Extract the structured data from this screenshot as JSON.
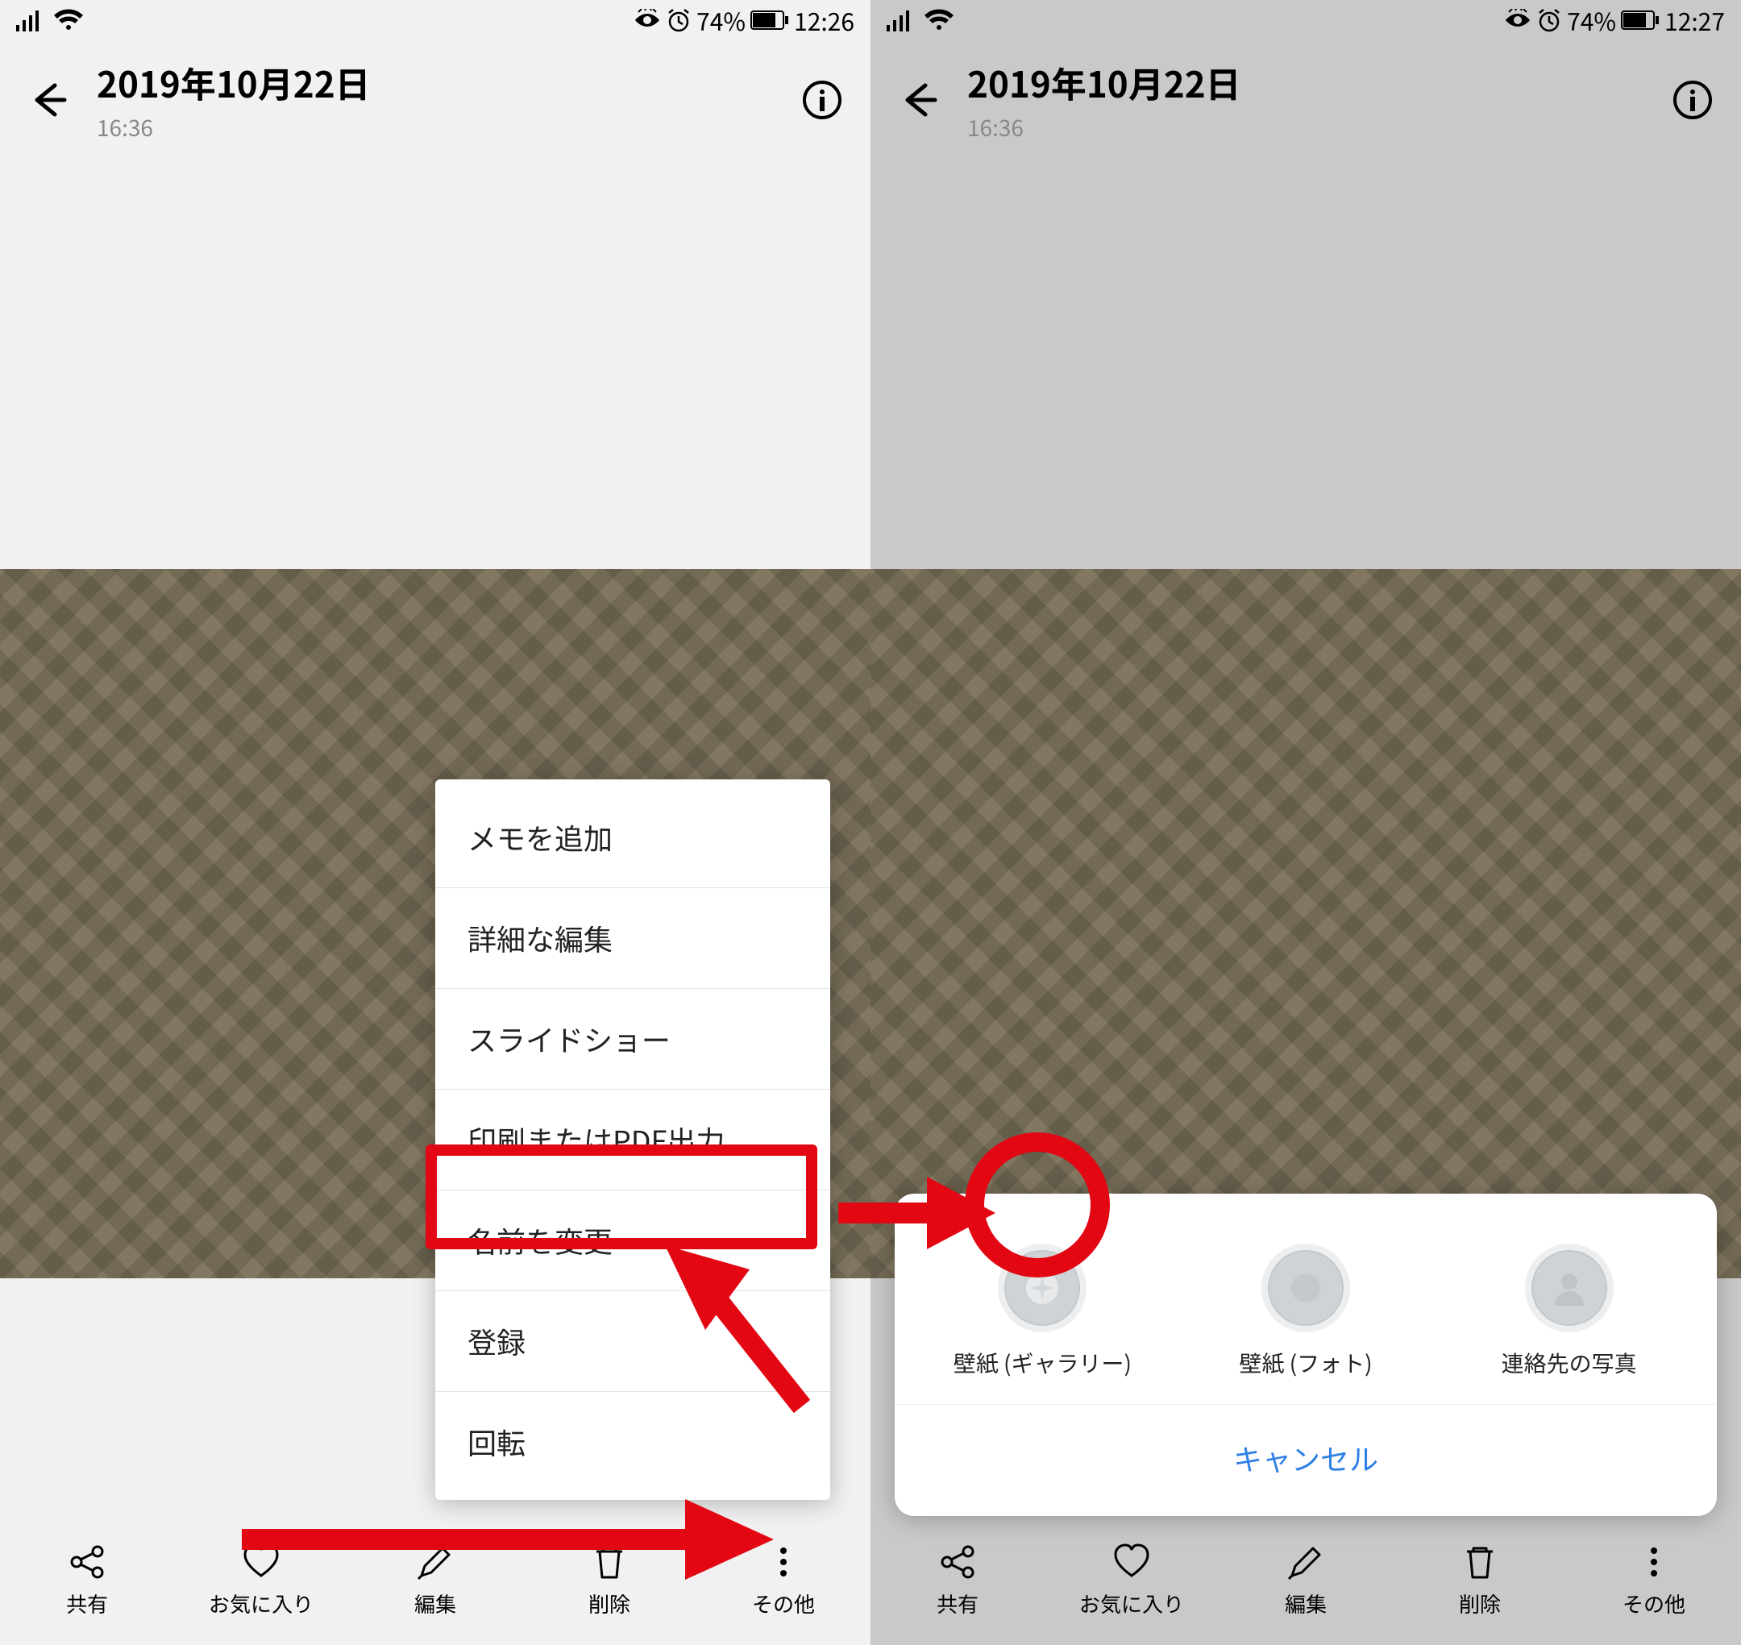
{
  "left": {
    "status": {
      "battery_pct": "74%",
      "clock": "12:26"
    },
    "header": {
      "date": "2019年10月22日",
      "time": "16:36"
    },
    "menu": {
      "items": [
        "メモを追加",
        "詳細な編集",
        "スライドショー",
        "印刷またはPDF出力",
        "名前を変更",
        "登録",
        "回転"
      ]
    },
    "nav": {
      "share": "共有",
      "favorite": "お気に入り",
      "edit": "編集",
      "delete": "削除",
      "more": "その他"
    }
  },
  "right": {
    "status": {
      "battery_pct": "74%",
      "clock": "12:27"
    },
    "header": {
      "date": "2019年10月22日",
      "time": "16:36"
    },
    "sheet": {
      "options": [
        "壁紙 (ギャラリー)",
        "壁紙 (フォト)",
        "連絡先の写真"
      ],
      "cancel": "キャンセル"
    },
    "nav": {
      "share": "共有",
      "favorite": "お気に入り",
      "edit": "編集",
      "delete": "削除",
      "more": "その他"
    }
  }
}
